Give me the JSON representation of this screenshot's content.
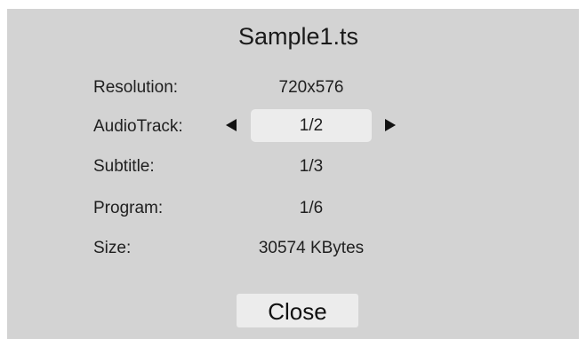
{
  "dialog": {
    "title": "Sample1.ts",
    "rows": [
      {
        "label": "Resolution:",
        "value": "720x576"
      },
      {
        "label": "AudioTrack:",
        "value": "1/2"
      },
      {
        "label": "Subtitle:",
        "value": "1/3"
      },
      {
        "label": "Program:",
        "value": "1/6"
      },
      {
        "label": "Size:",
        "value": "30574 KBytes"
      }
    ],
    "close_label": "Close"
  },
  "icons": {
    "prev": "triangle-left-icon",
    "next": "triangle-right-icon"
  },
  "colors": {
    "dialog_background": "#d3d3d3",
    "selected_field": "#ececec",
    "text": "#1f1f1f"
  }
}
